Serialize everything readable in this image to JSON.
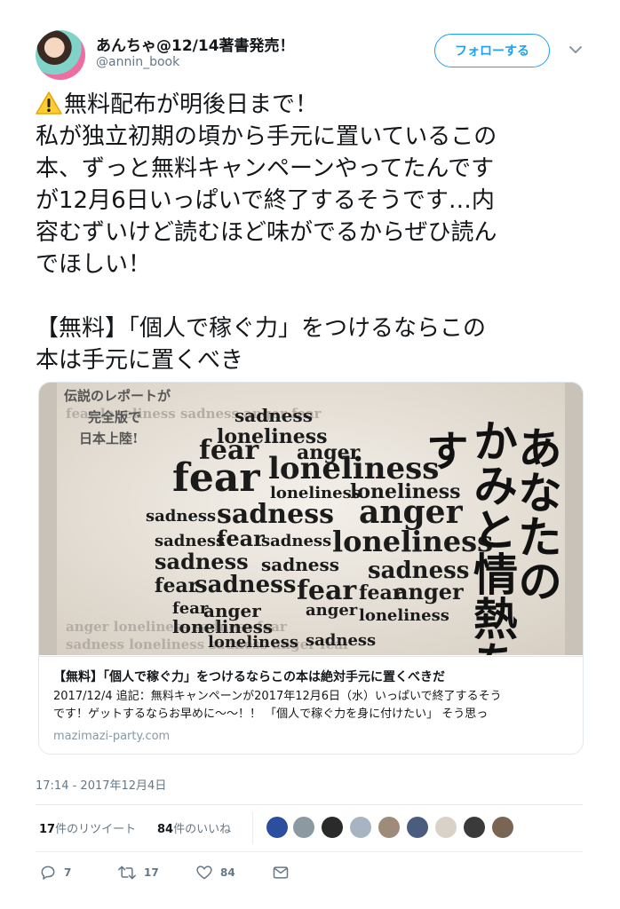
{
  "header": {
    "name": "あんちゃ@12/14著書発売！",
    "handle": "@annin_book",
    "follow_label": "フォローする"
  },
  "tweet": {
    "lines": [
      "無料配布が明後日まで！",
      "私が独立初期の頃から手元に置いているこの",
      "本、ずっと無料キャンペーンやってたんです",
      "が12月6日いっぱいで終了するそうです…内",
      "容むずいけど読むほど味がでるからぜひ読ん",
      "でほしい！",
      "",
      "【無料】「個人で稼ぐ力」をつけるならこの",
      "本は手元に置くべき"
    ]
  },
  "card": {
    "title": "【無料】「個人で稼ぐ力」をつけるならこの本は絶対手元に置くべきだ",
    "desc_line1": "2017/12/4 追記：無料キャンペーンが2017年12月6日（水）いっぱいで終了するそう",
    "desc_line2": "です！ゲットするならお早めに〜〜！！ 「個人で稼ぐ力を身に付けたい」 そう思っ",
    "url": "mazimazi-party.com",
    "image_text": {
      "top_left": [
        "伝説のレポートが",
        "完全版で",
        "日本上陸!"
      ],
      "vertical_col1": "あなたの",
      "vertical_col2": "かみと情熱を",
      "vertical_col3": "す",
      "words": [
        "sadness",
        "loneliness",
        "fear",
        "anger"
      ]
    }
  },
  "timestamp": "17:14 - 2017年12月4日",
  "stats": {
    "retweet_count": "17",
    "retweet_suffix": "件のリツイート",
    "like_count": "84",
    "like_suffix": "件のいいね"
  },
  "actions": {
    "reply_count": "7",
    "retweet_count": "17",
    "like_count": "84"
  },
  "colors": {
    "accent": "#1da1f2",
    "muted": "#657786"
  }
}
